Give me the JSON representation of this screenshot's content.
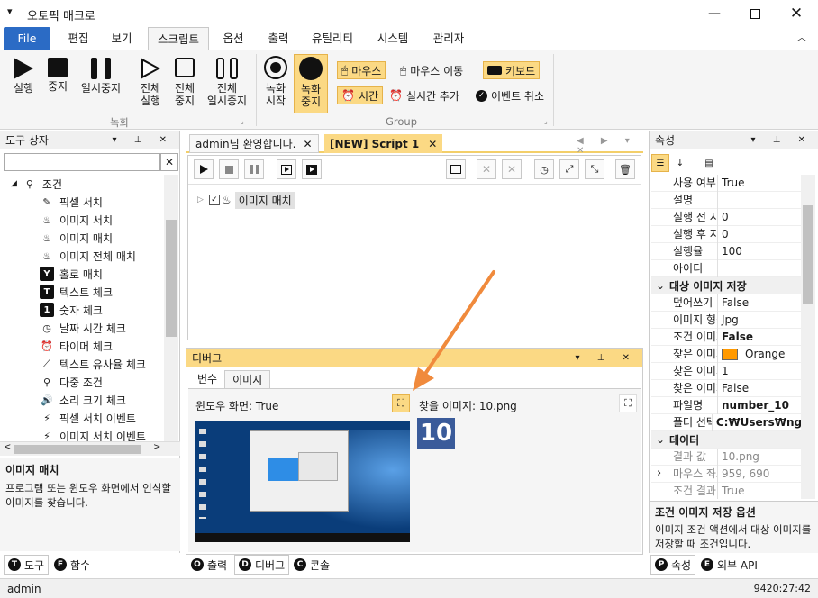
{
  "window": {
    "title": "오토픽 매크로"
  },
  "menu": {
    "file": "File",
    "items": [
      "편집",
      "보기",
      "스크립트",
      "옵션",
      "출력",
      "유틸리티",
      "시스템",
      "관리자"
    ]
  },
  "ribbon": {
    "run": "실행",
    "stop": "중지",
    "pause": "일시중지",
    "run_all_1": "전체",
    "run_all_2": "실행",
    "stop_all_1": "전체",
    "stop_all_2": "중지",
    "pause_all_1": "전체",
    "pause_all_2": "일시중지",
    "group_record": "녹화",
    "rec_start_1": "녹화",
    "rec_start_2": "시작",
    "rec_stop_1": "녹화",
    "rec_stop_2": "중지",
    "mouse": "마우스",
    "mouse_move": "마우스 이동",
    "keyboard": "키보드",
    "time": "시간",
    "realtime_add": "실시간 추가",
    "event_cancel": "이벤트 취소",
    "group_label": "Group"
  },
  "toolbox": {
    "title": "도구 상자",
    "root": "조건",
    "items": [
      "픽셀 서치",
      "이미지 서치",
      "이미지 매치",
      "이미지 전체 매치",
      "홀로 매치",
      "텍스트 체크",
      "숫자 체크",
      "날짜 시간 체크",
      "타이머 체크",
      "텍스트 유사율 체크",
      "다중 조건",
      "소리 크기 체크",
      "픽셀 서치 이벤트",
      "이미지 서치 이벤트"
    ],
    "desc_title": "이미지 매치",
    "desc_text": "프로그램 또는 윈도우 화면에서 인식할 이미지를 찾습니다."
  },
  "tabs": {
    "welcome": "admin님 환영합니다.",
    "script": "[NEW] Script 1"
  },
  "script": {
    "node": "이미지 매치"
  },
  "debug": {
    "title": "디버그",
    "tab_vars": "변수",
    "tab_image": "이미지",
    "window_label": "윈도우 화면: True",
    "found_label": "찾을 이미지: 10.png",
    "found_value": "10"
  },
  "props": {
    "title": "속성",
    "rows": [
      {
        "k": "사용 여부",
        "v": "True"
      },
      {
        "k": "설명",
        "v": ""
      },
      {
        "k": "실행 전 지연",
        "v": "0"
      },
      {
        "k": "실행 후 지연",
        "v": "0"
      },
      {
        "k": "실행율",
        "v": "100"
      },
      {
        "k": "아이디",
        "v": ""
      }
    ],
    "section1": "대상 이미지 저장",
    "rows2": [
      {
        "k": "덮어쓰기",
        "v": "False"
      },
      {
        "k": "이미지 형식",
        "v": "Jpg"
      },
      {
        "k": "조건 이미지",
        "v": "False"
      },
      {
        "k": "찾은 이미지",
        "v": "Orange"
      },
      {
        "k": "찾은 이미지",
        "v": "1"
      },
      {
        "k": "찾은 이미지",
        "v": "False"
      },
      {
        "k": "파일명",
        "v": "number_10"
      },
      {
        "k": "폴더 선택",
        "v": "C:₩Users₩ngm"
      }
    ],
    "section2": "데이터",
    "rows3": [
      {
        "k": "결과 값",
        "v": "10.png"
      },
      {
        "k": "마우스 좌표",
        "v": "959, 690"
      },
      {
        "k": "조건 결과",
        "v": "True"
      }
    ],
    "desc_title": "조건 이미지 저장 옵션",
    "desc_text": "이미지 조건 액션에서 대상 이미지를 저장할 때 조건입니다."
  },
  "bottom_tabs": {
    "tool": "도구",
    "func": "함수",
    "output": "출력",
    "debug": "디버그",
    "console": "콘솔",
    "props": "속성",
    "api": "외부 API"
  },
  "status": {
    "user": "admin",
    "time": "9420:27:42"
  },
  "colors": {
    "accent": "#2b6bc5",
    "highlight": "#fbd984",
    "orange": "#ff9900",
    "arrow": "#f08a3c"
  }
}
